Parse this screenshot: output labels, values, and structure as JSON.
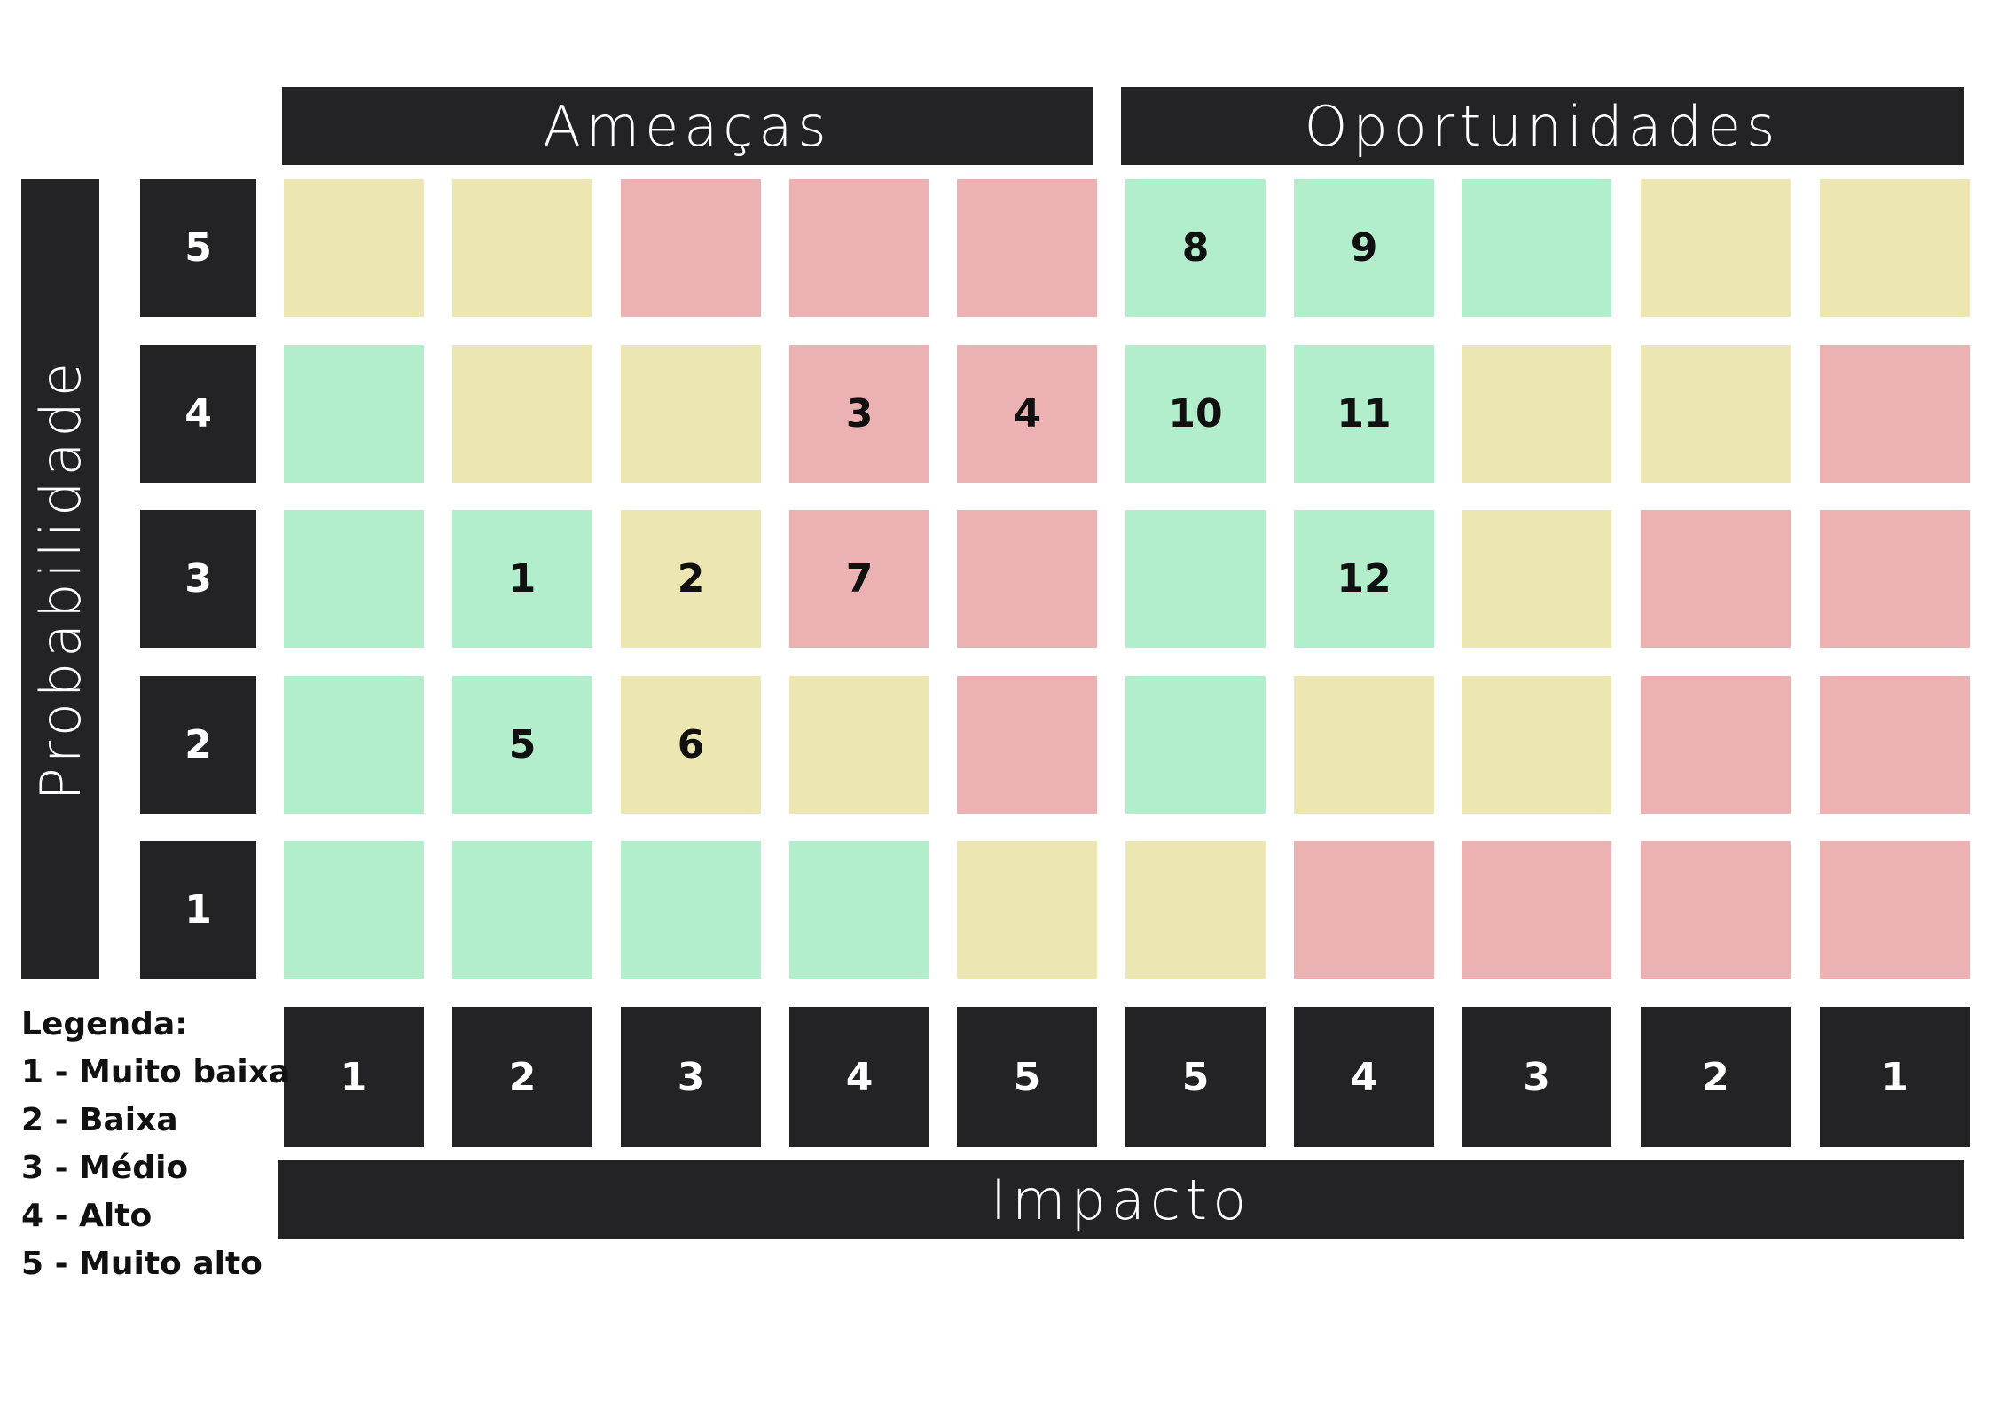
{
  "headers": {
    "left": "Ameaças",
    "right": "Oportunidades",
    "bottom": "Impacto",
    "vertical": "Probabilidade"
  },
  "colors": {
    "dark": "#232325",
    "green": "#b2edcc",
    "yellow": "#ece7b2",
    "red": "#ecb2b3"
  },
  "probability_labels": [
    "5",
    "4",
    "3",
    "2",
    "1"
  ],
  "impact_labels": [
    "1",
    "2",
    "3",
    "4",
    "5",
    "5",
    "4",
    "3",
    "2",
    "1"
  ],
  "grid": [
    [
      {
        "color": "yellow",
        "label": ""
      },
      {
        "color": "yellow",
        "label": ""
      },
      {
        "color": "red",
        "label": ""
      },
      {
        "color": "red",
        "label": ""
      },
      {
        "color": "red",
        "label": ""
      },
      {
        "color": "green",
        "label": "8"
      },
      {
        "color": "green",
        "label": "9"
      },
      {
        "color": "green",
        "label": ""
      },
      {
        "color": "yellow",
        "label": ""
      },
      {
        "color": "yellow",
        "label": ""
      }
    ],
    [
      {
        "color": "green",
        "label": ""
      },
      {
        "color": "yellow",
        "label": ""
      },
      {
        "color": "yellow",
        "label": ""
      },
      {
        "color": "red",
        "label": "3"
      },
      {
        "color": "red",
        "label": "4"
      },
      {
        "color": "green",
        "label": "10"
      },
      {
        "color": "green",
        "label": "11"
      },
      {
        "color": "yellow",
        "label": ""
      },
      {
        "color": "yellow",
        "label": ""
      },
      {
        "color": "red",
        "label": ""
      }
    ],
    [
      {
        "color": "green",
        "label": ""
      },
      {
        "color": "green",
        "label": "1"
      },
      {
        "color": "yellow",
        "label": "2"
      },
      {
        "color": "red",
        "label": "7"
      },
      {
        "color": "red",
        "label": ""
      },
      {
        "color": "green",
        "label": ""
      },
      {
        "color": "green",
        "label": "12"
      },
      {
        "color": "yellow",
        "label": ""
      },
      {
        "color": "red",
        "label": ""
      },
      {
        "color": "red",
        "label": ""
      }
    ],
    [
      {
        "color": "green",
        "label": ""
      },
      {
        "color": "green",
        "label": "5"
      },
      {
        "color": "yellow",
        "label": "6"
      },
      {
        "color": "yellow",
        "label": ""
      },
      {
        "color": "red",
        "label": ""
      },
      {
        "color": "green",
        "label": ""
      },
      {
        "color": "yellow",
        "label": ""
      },
      {
        "color": "yellow",
        "label": ""
      },
      {
        "color": "red",
        "label": ""
      },
      {
        "color": "red",
        "label": ""
      }
    ],
    [
      {
        "color": "green",
        "label": ""
      },
      {
        "color": "green",
        "label": ""
      },
      {
        "color": "green",
        "label": ""
      },
      {
        "color": "green",
        "label": ""
      },
      {
        "color": "yellow",
        "label": ""
      },
      {
        "color": "yellow",
        "label": ""
      },
      {
        "color": "red",
        "label": ""
      },
      {
        "color": "red",
        "label": ""
      },
      {
        "color": "red",
        "label": ""
      },
      {
        "color": "red",
        "label": ""
      }
    ]
  ],
  "legend": {
    "title": "Legenda:",
    "items": [
      "1 - Muito baixa",
      "2 - Baixa",
      "3 - Médio",
      "4 - Alto",
      "5 - Muito alto"
    ]
  }
}
